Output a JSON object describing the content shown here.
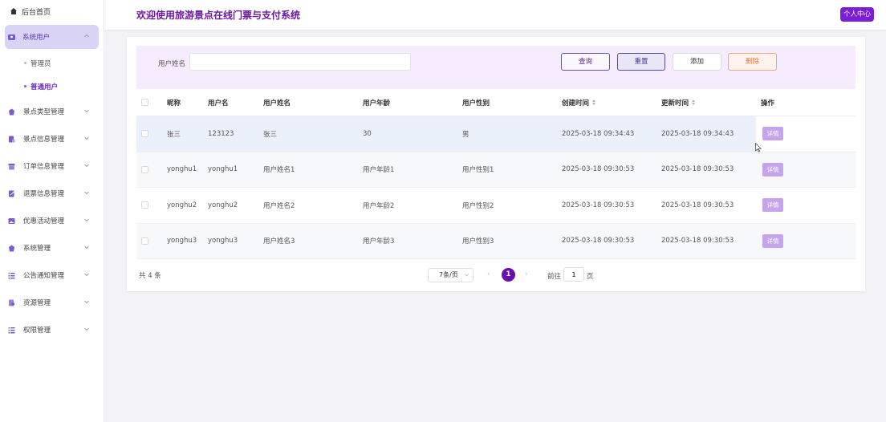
{
  "sidebar": {
    "home": "后台首页",
    "group_active": "系统用户",
    "sub_items": [
      "管理员",
      "普通用户"
    ],
    "items": [
      "景点类型管理",
      "景点信息管理",
      "订单信息管理",
      "退票信息管理",
      "优惠活动管理",
      "系统管理",
      "公告通知管理",
      "资源管理",
      "权限管理"
    ]
  },
  "header": {
    "title": "欢迎使用旅游景点在线门票与支付系统",
    "profile": "个人中心"
  },
  "search": {
    "label": "用户姓名",
    "value": "",
    "placeholder": "",
    "query": "查询",
    "reset": "重置",
    "add": "添加",
    "delete": "删除"
  },
  "table": {
    "columns": [
      "昵称",
      "用户名",
      "用户姓名",
      "用户年龄",
      "用户性别",
      "创建时间",
      "更新时间",
      "操作"
    ],
    "rows": [
      [
        "张三",
        "123123",
        "张三",
        "30",
        "男",
        "2025-03-18 09:34:43",
        "2025-03-18 09:34:43"
      ],
      [
        "yonghu1",
        "yonghu1",
        "用户姓名1",
        "用户年龄1",
        "用户性别1",
        "2025-03-18 09:30:53",
        "2025-03-18 09:30:53"
      ],
      [
        "yonghu2",
        "yonghu2",
        "用户姓名2",
        "用户年龄2",
        "用户性别2",
        "2025-03-18 09:30:53",
        "2025-03-18 09:30:53"
      ],
      [
        "yonghu3",
        "yonghu3",
        "用户姓名3",
        "用户年龄3",
        "用户性别3",
        "2025-03-18 09:30:53",
        "2025-03-18 09:30:53"
      ]
    ],
    "detail_label": "详情"
  },
  "pagination": {
    "total": "共 4 条",
    "page_size": "7条/页",
    "current": "1",
    "goto_label": "前往",
    "goto_value": "1",
    "page_unit": "页"
  },
  "colors": {
    "accent": "#6a0dad",
    "title": "#6a1b9a",
    "search_bg": "#f7ecfd",
    "detail_btn": "#c6a4ec"
  }
}
